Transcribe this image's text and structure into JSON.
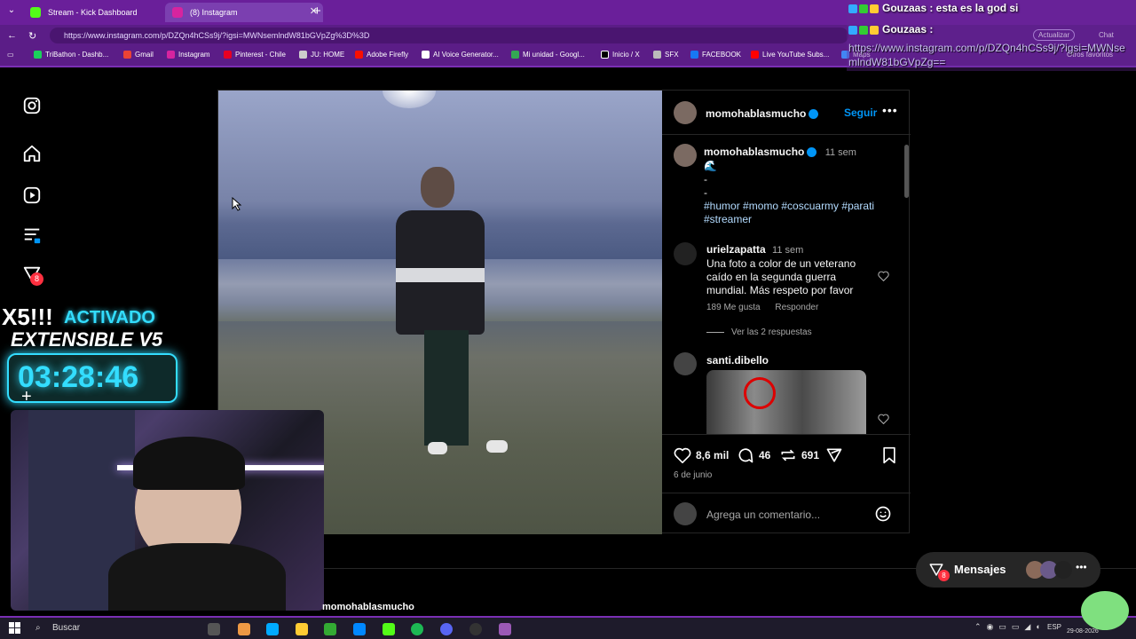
{
  "browser": {
    "tabs": [
      {
        "label": "Stream - Kick Dashboard",
        "active": false
      },
      {
        "label": "(8) Instagram",
        "active": true
      }
    ],
    "address": "https://www.instagram.com/p/DZQn4hCSs9j/?igsi=MWNsemlndW81bGVpZg%3D%3D",
    "actualizar_label": "Actualizar",
    "chat_label": "Chat",
    "bookmarks": [
      {
        "label": "TriBathon - Dashb...",
        "color": "#1ad05b"
      },
      {
        "label": "Gmail",
        "color": "#ea4335"
      },
      {
        "label": "Instagram",
        "color": "#d6249f"
      },
      {
        "label": "Pinterest - Chile",
        "color": "#e60023"
      },
      {
        "label": "JU: HOME",
        "color": "#cccccc"
      },
      {
        "label": "Adobe Firefly",
        "color": "#fa0f00"
      },
      {
        "label": "AI Voice Generator...",
        "color": "#ffffff"
      },
      {
        "label": "Mi unidad - Googl...",
        "color": "#34a853"
      },
      {
        "label": "Inicio / X",
        "color": "#000000"
      },
      {
        "label": "SFX",
        "color": "#bbbbbb"
      },
      {
        "label": "FACEBOOK",
        "color": "#1877f2"
      },
      {
        "label": "Live YouTube Subs...",
        "color": "#ff0000"
      },
      {
        "label": "Maps",
        "color": "#4285f4"
      }
    ],
    "otros_favoritos": "Otros favoritos"
  },
  "stream_chat": {
    "line1": "Gouzaas : esta es la god si",
    "line2": "Gouzaas :",
    "url": "https://www.instagram.com/p/DZQn4hCSs9j/?igsi=MWNsemlndW81bGVpZg=="
  },
  "overlay": {
    "x5_text": "X5!!!",
    "activado_text": "ACTIVADO",
    "extensible_text": "EXTENSIBLE V5",
    "timer": "03:28:46"
  },
  "sidebar": {
    "notification_count": "8"
  },
  "post": {
    "author": "momohablasmucho",
    "follow_label": "Seguir",
    "caption_time": "11 sem",
    "caption_emoji": "🌊",
    "caption_line2": "-",
    "caption_line3": "-",
    "hashtags_line1": "#humor #momo #coscuarmy #parati",
    "hashtags_line2": "#streamer",
    "comments": [
      {
        "user": "urielzapatta",
        "time": "11 sem",
        "text": "Una foto a color de un veterano caído en la segunda guerra mundial. Más respeto por favor",
        "likes": "189 Me gusta",
        "reply_label": "Responder",
        "view_replies": "Ver las 2 respuestas"
      },
      {
        "user": "santi.dibello"
      }
    ],
    "like_count": "8,6 mil",
    "comment_count": "46",
    "share_count": "691",
    "date": "6 de junio",
    "comment_placeholder": "Agrega un comentario..."
  },
  "messages": {
    "label": "Mensajes",
    "badge": "8"
  },
  "bottom_username": "momohablasmucho",
  "taskbar": {
    "search_label": "Buscar",
    "lang": "ESP",
    "date": "29-08-2026"
  }
}
